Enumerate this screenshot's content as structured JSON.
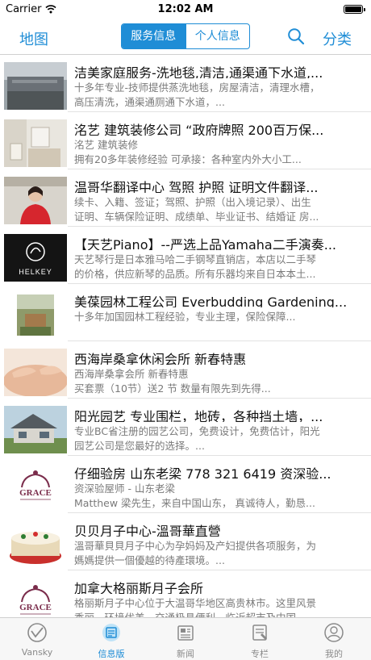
{
  "status_bar": {
    "carrier": "Carrier",
    "time": "12:02 AM"
  },
  "nav": {
    "left": "地图",
    "segments": [
      "服务信息",
      "个人信息"
    ],
    "active_segment": 0,
    "right": "分类",
    "accent": "#1f8dd6"
  },
  "listings": [
    {
      "title": "洁美家庭服务-洗地毯,清洁,通渠通下水道,...",
      "desc1": "十多年专业-技师提供蒸洗地毯，房屋清洁，清理水槽，",
      "desc2": "高压清洗，通渠通厕通下水道，...",
      "thumb": "building"
    },
    {
      "title": "洺艺  建筑装修公司 “政府牌照  200百万保...",
      "desc1": "洺艺  建筑装修",
      "desc2": "拥有20多年装修经验   可承接：各种室内外大小工...",
      "thumb": "interior"
    },
    {
      "title": "温哥华翻译中心  驾照  护照  证明文件翻译...",
      "desc1": "续卡、入籍、签证；驾照、护照（出入境记录）、出生",
      "desc2": "证明、车辆保险证明、成绩单、毕业证书、结婚证  房...",
      "thumb": "portrait"
    },
    {
      "title": "【天艺Piano】--严选上品Yamaha二手演奏...",
      "desc1": "天艺琴行是日本雅马哈二手钢琴直销店，本店以二手琴",
      "desc2": "的价格，供应新琴的品质。所有乐器均来自日本本土...",
      "thumb": "helkey",
      "logo_text": "HELKEY"
    },
    {
      "title": "美葆园林工程公司 Everbudding Gardening...",
      "desc1": "十多年加国园林工程经验，专业主理，保险保障...",
      "desc2": "",
      "thumb": "garden"
    },
    {
      "title": "西海岸桑拿休闲会所  新春特惠",
      "desc1": "西海岸桑拿会所  新春特惠",
      "desc2": "买套票（10节）送2 节  数量有限先到先得...",
      "thumb": "massage"
    },
    {
      "title": "阳光园艺  专业围栏，地砖，各种挡土墙，...",
      "desc1": "专业BC省注册的园艺公司，免费设计，免费估计，阳光",
      "desc2": "园艺公司是您最好的选择。...",
      "thumb": "house"
    },
    {
      "title": "仔细验房  山东老梁  778 321 6419 资深验...",
      "desc1": "资深验屋师 - 山东老梁",
      "desc2": "Matthew 梁先生，来自中国山东，  真诚待人，勤恳...",
      "thumb": "grace",
      "logo_text": "GRACE"
    },
    {
      "title": "贝贝月子中心-溫哥華直營",
      "desc1": "溫哥華貝貝月子中心为孕妈妈及产妇提供各项服务，为",
      "desc2": "媽媽提供一個優越的待產環境。...",
      "thumb": "cake"
    },
    {
      "title": "加拿大格丽斯月子会所",
      "desc1": "格丽斯月子中心位于大温哥华地区高贵林市。这里风景",
      "desc2": "秀丽，环境优美，交通极具便利，临近超市及中国...",
      "thumb": "grace",
      "logo_text": "GRACE"
    }
  ],
  "tabs": [
    {
      "label": "Vansky",
      "icon": "vansky-logo-icon"
    },
    {
      "label": "信息版",
      "icon": "info-board-icon"
    },
    {
      "label": "新闻",
      "icon": "news-icon"
    },
    {
      "label": "专栏",
      "icon": "column-icon"
    },
    {
      "label": "我的",
      "icon": "profile-icon"
    }
  ],
  "active_tab": 1
}
